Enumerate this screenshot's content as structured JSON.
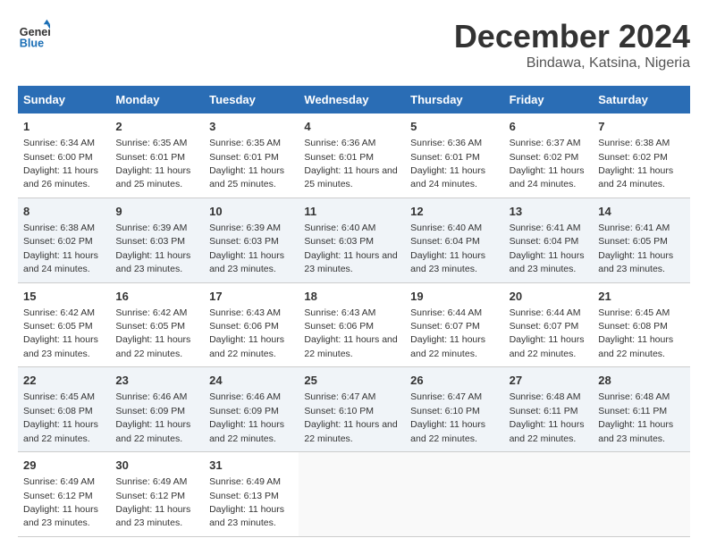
{
  "logo": {
    "line1": "General",
    "line2": "Blue"
  },
  "title": "December 2024",
  "subtitle": "Bindawa, Katsina, Nigeria",
  "headers": [
    "Sunday",
    "Monday",
    "Tuesday",
    "Wednesday",
    "Thursday",
    "Friday",
    "Saturday"
  ],
  "weeks": [
    [
      {
        "day": "1",
        "sunrise": "6:34 AM",
        "sunset": "6:00 PM",
        "daylight": "11 hours and 26 minutes."
      },
      {
        "day": "2",
        "sunrise": "6:35 AM",
        "sunset": "6:01 PM",
        "daylight": "11 hours and 25 minutes."
      },
      {
        "day": "3",
        "sunrise": "6:35 AM",
        "sunset": "6:01 PM",
        "daylight": "11 hours and 25 minutes."
      },
      {
        "day": "4",
        "sunrise": "6:36 AM",
        "sunset": "6:01 PM",
        "daylight": "11 hours and 25 minutes."
      },
      {
        "day": "5",
        "sunrise": "6:36 AM",
        "sunset": "6:01 PM",
        "daylight": "11 hours and 24 minutes."
      },
      {
        "day": "6",
        "sunrise": "6:37 AM",
        "sunset": "6:02 PM",
        "daylight": "11 hours and 24 minutes."
      },
      {
        "day": "7",
        "sunrise": "6:38 AM",
        "sunset": "6:02 PM",
        "daylight": "11 hours and 24 minutes."
      }
    ],
    [
      {
        "day": "8",
        "sunrise": "6:38 AM",
        "sunset": "6:02 PM",
        "daylight": "11 hours and 24 minutes."
      },
      {
        "day": "9",
        "sunrise": "6:39 AM",
        "sunset": "6:03 PM",
        "daylight": "11 hours and 23 minutes."
      },
      {
        "day": "10",
        "sunrise": "6:39 AM",
        "sunset": "6:03 PM",
        "daylight": "11 hours and 23 minutes."
      },
      {
        "day": "11",
        "sunrise": "6:40 AM",
        "sunset": "6:03 PM",
        "daylight": "11 hours and 23 minutes."
      },
      {
        "day": "12",
        "sunrise": "6:40 AM",
        "sunset": "6:04 PM",
        "daylight": "11 hours and 23 minutes."
      },
      {
        "day": "13",
        "sunrise": "6:41 AM",
        "sunset": "6:04 PM",
        "daylight": "11 hours and 23 minutes."
      },
      {
        "day": "14",
        "sunrise": "6:41 AM",
        "sunset": "6:05 PM",
        "daylight": "11 hours and 23 minutes."
      }
    ],
    [
      {
        "day": "15",
        "sunrise": "6:42 AM",
        "sunset": "6:05 PM",
        "daylight": "11 hours and 23 minutes."
      },
      {
        "day": "16",
        "sunrise": "6:42 AM",
        "sunset": "6:05 PM",
        "daylight": "11 hours and 22 minutes."
      },
      {
        "day": "17",
        "sunrise": "6:43 AM",
        "sunset": "6:06 PM",
        "daylight": "11 hours and 22 minutes."
      },
      {
        "day": "18",
        "sunrise": "6:43 AM",
        "sunset": "6:06 PM",
        "daylight": "11 hours and 22 minutes."
      },
      {
        "day": "19",
        "sunrise": "6:44 AM",
        "sunset": "6:07 PM",
        "daylight": "11 hours and 22 minutes."
      },
      {
        "day": "20",
        "sunrise": "6:44 AM",
        "sunset": "6:07 PM",
        "daylight": "11 hours and 22 minutes."
      },
      {
        "day": "21",
        "sunrise": "6:45 AM",
        "sunset": "6:08 PM",
        "daylight": "11 hours and 22 minutes."
      }
    ],
    [
      {
        "day": "22",
        "sunrise": "6:45 AM",
        "sunset": "6:08 PM",
        "daylight": "11 hours and 22 minutes."
      },
      {
        "day": "23",
        "sunrise": "6:46 AM",
        "sunset": "6:09 PM",
        "daylight": "11 hours and 22 minutes."
      },
      {
        "day": "24",
        "sunrise": "6:46 AM",
        "sunset": "6:09 PM",
        "daylight": "11 hours and 22 minutes."
      },
      {
        "day": "25",
        "sunrise": "6:47 AM",
        "sunset": "6:10 PM",
        "daylight": "11 hours and 22 minutes."
      },
      {
        "day": "26",
        "sunrise": "6:47 AM",
        "sunset": "6:10 PM",
        "daylight": "11 hours and 22 minutes."
      },
      {
        "day": "27",
        "sunrise": "6:48 AM",
        "sunset": "6:11 PM",
        "daylight": "11 hours and 22 minutes."
      },
      {
        "day": "28",
        "sunrise": "6:48 AM",
        "sunset": "6:11 PM",
        "daylight": "11 hours and 23 minutes."
      }
    ],
    [
      {
        "day": "29",
        "sunrise": "6:49 AM",
        "sunset": "6:12 PM",
        "daylight": "11 hours and 23 minutes."
      },
      {
        "day": "30",
        "sunrise": "6:49 AM",
        "sunset": "6:12 PM",
        "daylight": "11 hours and 23 minutes."
      },
      {
        "day": "31",
        "sunrise": "6:49 AM",
        "sunset": "6:13 PM",
        "daylight": "11 hours and 23 minutes."
      },
      null,
      null,
      null,
      null
    ]
  ],
  "labels": {
    "sunrise_prefix": "Sunrise: ",
    "sunset_prefix": "Sunset: ",
    "daylight_prefix": "Daylight: "
  }
}
